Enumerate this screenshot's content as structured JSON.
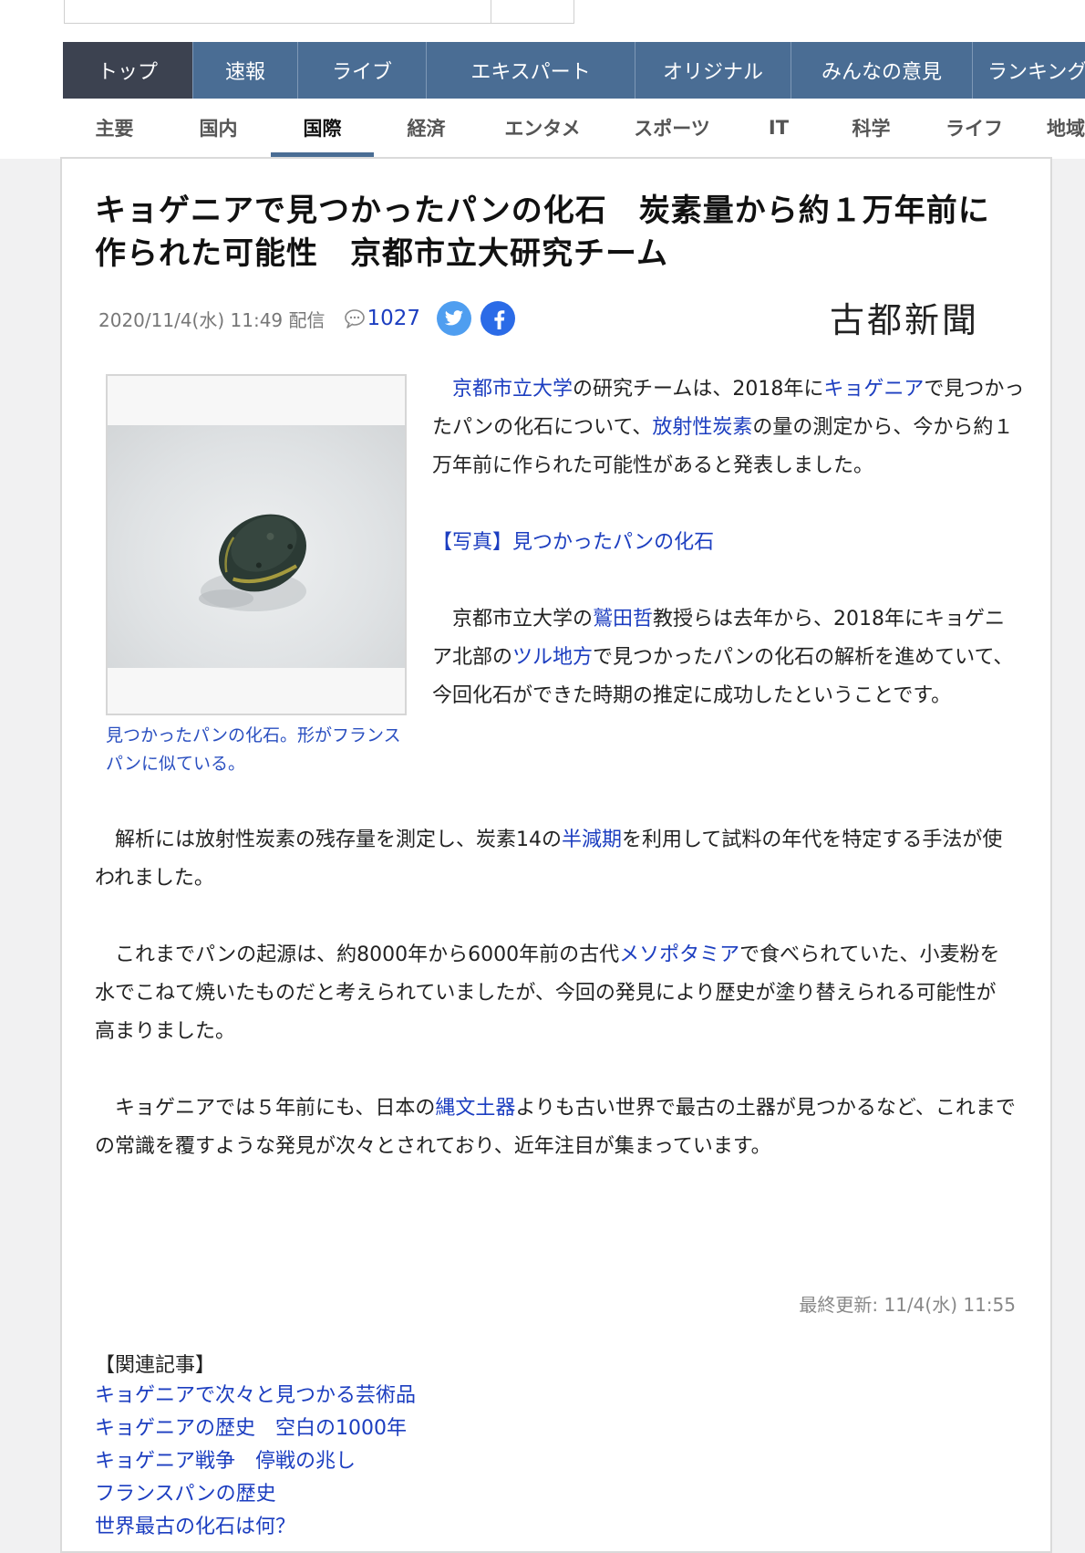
{
  "nav_main": [
    {
      "label": "トップ",
      "active": true
    },
    {
      "label": "速報",
      "active": false
    },
    {
      "label": "ライブ",
      "active": false
    },
    {
      "label": "エキスパート",
      "active": false
    },
    {
      "label": "オリジナル",
      "active": false
    },
    {
      "label": "みんなの意見",
      "active": false
    },
    {
      "label": "ランキング",
      "active": false
    }
  ],
  "nav_category": [
    {
      "label": "主要",
      "active": false
    },
    {
      "label": "国内",
      "active": false
    },
    {
      "label": "国際",
      "active": true
    },
    {
      "label": "経済",
      "active": false
    },
    {
      "label": "エンタメ",
      "active": false
    },
    {
      "label": "スポーツ",
      "active": false
    },
    {
      "label": "IT",
      "active": false
    },
    {
      "label": "科学",
      "active": false
    },
    {
      "label": "ライフ",
      "active": false
    },
    {
      "label": "地域",
      "active": false
    }
  ],
  "article": {
    "title": "キョゲニアで見つかったパンの化石　炭素量から約１万年前に作られた可能性　京都市立大研究チーム",
    "date": "2020/11/4(水) 11:49 配信",
    "comment_count": "1027",
    "publisher": "古都新聞",
    "photo_caption": "見つかったパンの化石。形がフランスパンに似ている。",
    "p1": {
      "link1": "京都市立大学",
      "text1": "の研究チームは、2018年に",
      "link2": "キョゲニア",
      "text2": "で見つかったパンの化石について、",
      "link3": "放射性炭素",
      "text3": "の量の測定から、今から約１万年前に作られた可能性があると発表しました。"
    },
    "photo_link": "【写真】見つかったパンの化石",
    "p3": {
      "text1": "京都市立大学の",
      "link1": "鷲田哲",
      "text2": "教授らは去年から、2018年にキョゲニア北部の",
      "link2": "ツル地方",
      "text3": "で見つかったパンの化石の解析を進めていて、今回化石ができた時期の推定に成功したということです。"
    },
    "p4": {
      "text1": "解析には放射性炭素の残存量を測定し、炭素14の",
      "link1": "半減期",
      "text2": "を利用して試料の年代を特定する手法が使われました。"
    },
    "p5": {
      "text1": "これまでパンの起源は、約8000年から6000年前の古代",
      "link1": "メソポタミア",
      "text2": "で食べられていた、小麦粉を水でこねて焼いたものだと考えられていましたが、今回の発見により歴史が塗り替えられる可能性が高まりました。"
    },
    "p6": {
      "text1": "キョゲニアでは５年前にも、日本の",
      "link1": "縄文土器",
      "text2": "よりも古い世界で最古の土器が見つかるなど、これまでの常識を覆すような発見が次々とされており、近年注目が集まっています。"
    },
    "updated": "最終更新: 11/4(水) 11:55",
    "related_heading": "【関連記事】",
    "related": [
      "キョゲニアで次々と見つかる芸術品",
      "キョゲニアの歴史　空白の1000年",
      "キョゲニア戦争　停戦の兆し",
      "フランスパンの歴史",
      "世界最古の化石は何？"
    ]
  },
  "icons": {
    "comment": "comment-bubble-icon",
    "twitter": "twitter-icon",
    "facebook": "facebook-icon"
  },
  "colors": {
    "nav_bg": "#4a6d94",
    "nav_active": "#3c4250",
    "link": "#1c3ec0",
    "twitter": "#4f9ef0",
    "facebook": "#2b6be7"
  }
}
